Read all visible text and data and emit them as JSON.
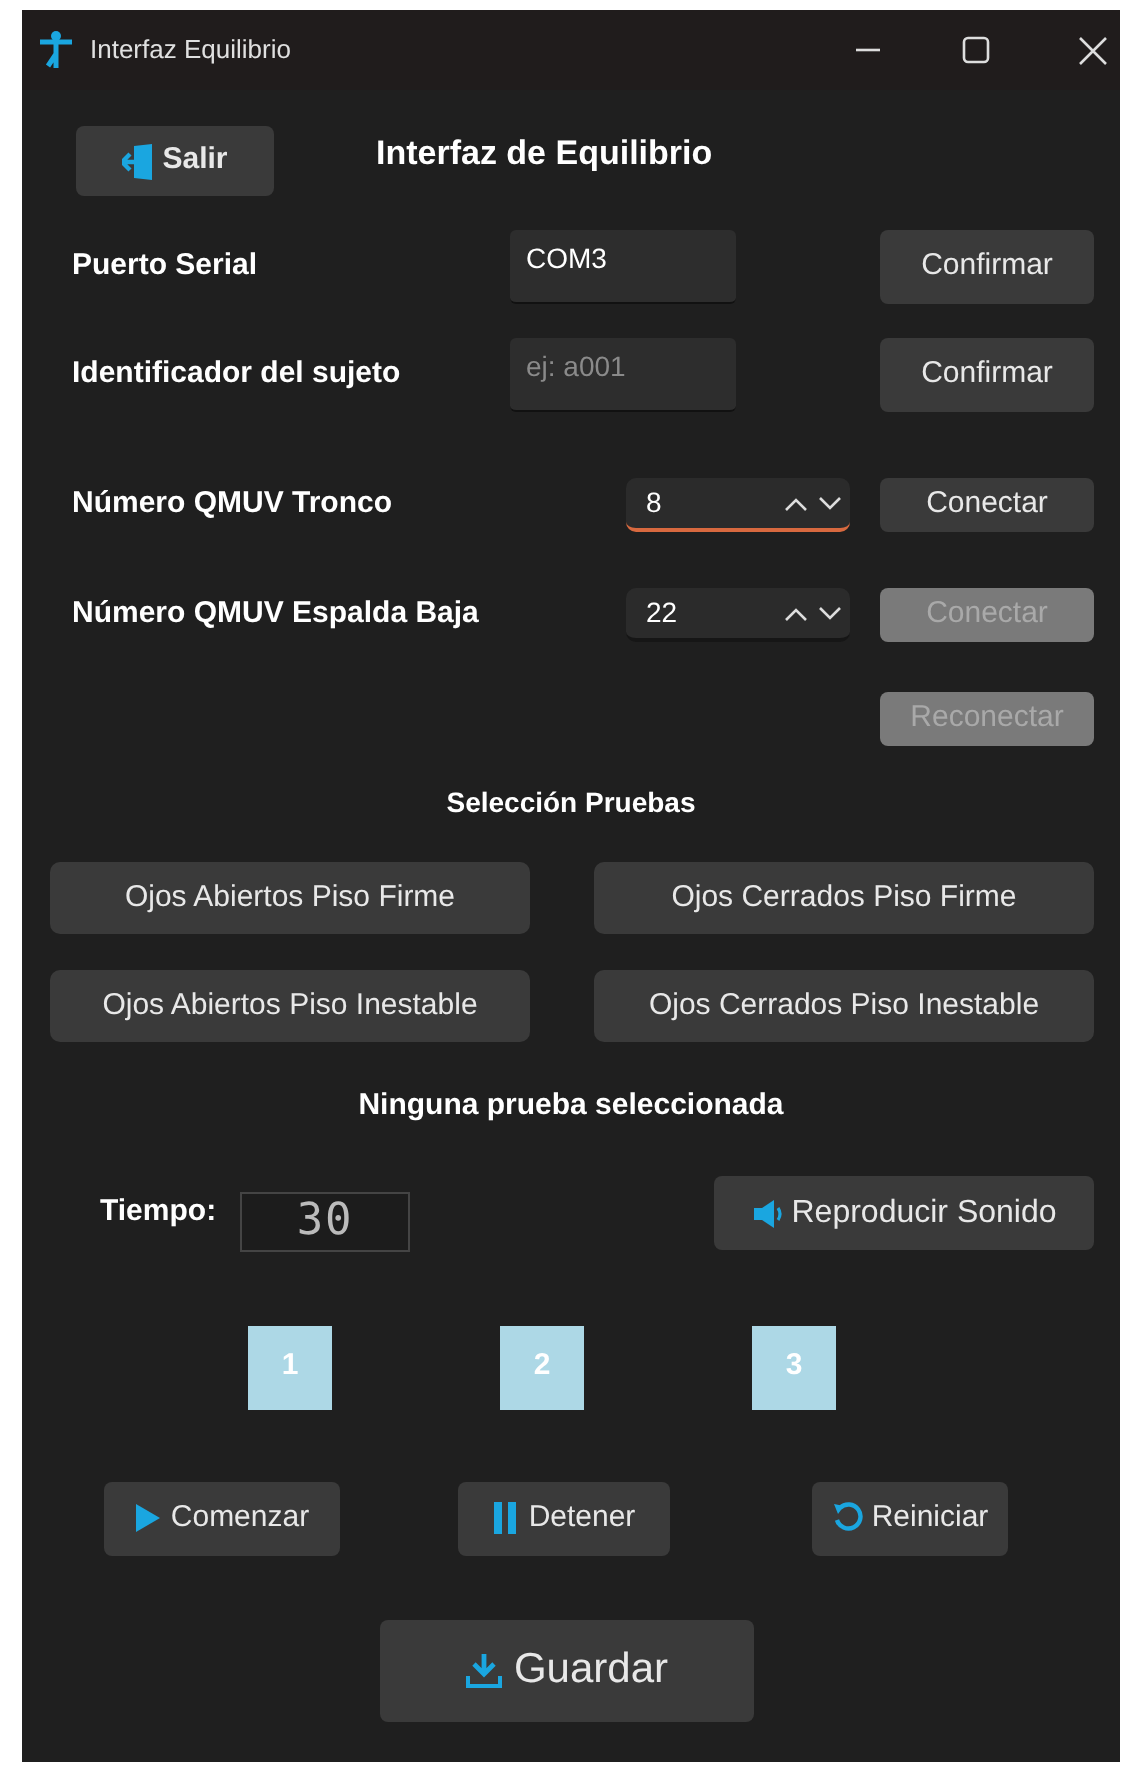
{
  "window": {
    "title": "Interfaz Equilibrio"
  },
  "exit_button": {
    "label": "Salir"
  },
  "heading": "Interfaz de Equilibrio",
  "text_rows": [
    {
      "label": "Puerto Serial",
      "value": "COM3",
      "button": "Confirmar"
    },
    {
      "label": "Identificador del sujeto",
      "placeholder": "ej: a001",
      "button": "Confirmar"
    }
  ],
  "sensor_rows": [
    {
      "label": "Número QMUV Tronco",
      "value": "8",
      "focused": true,
      "button": "Conectar",
      "disabled": false
    },
    {
      "label": "Número QMUV Espalda Baja",
      "value": "22",
      "focused": false,
      "button": "Conectar",
      "disabled": true
    }
  ],
  "reconnect_button": {
    "label": "Reconectar",
    "disabled": true
  },
  "tests_heading": "Selección Pruebas",
  "tests": [
    {
      "label": "Ojos Abiertos Piso Firme",
      "selected": false
    },
    {
      "label": "Ojos Cerrados Piso Firme",
      "selected": false
    },
    {
      "label": "Ojos Abiertos Piso Inestable",
      "selected": false
    },
    {
      "label": "Ojos Cerrados Piso Inestable",
      "selected": false
    }
  ],
  "test_status": "Ninguna prueba seleccionada",
  "timer": {
    "label": "Tiempo:",
    "value": "30"
  },
  "sound_button": {
    "label": "Reproducir Sonido"
  },
  "steps": [
    {
      "label": "1",
      "color": "#add8e6"
    },
    {
      "label": "2",
      "color": "#add8e6"
    },
    {
      "label": "3",
      "color": "#add8e6"
    }
  ],
  "controls": [
    {
      "kind": "play",
      "label": "Comenzar"
    },
    {
      "kind": "pause",
      "label": "Detener"
    },
    {
      "kind": "restart",
      "label": "Reiniciar"
    }
  ],
  "save_button": {
    "label": "Guardar"
  }
}
